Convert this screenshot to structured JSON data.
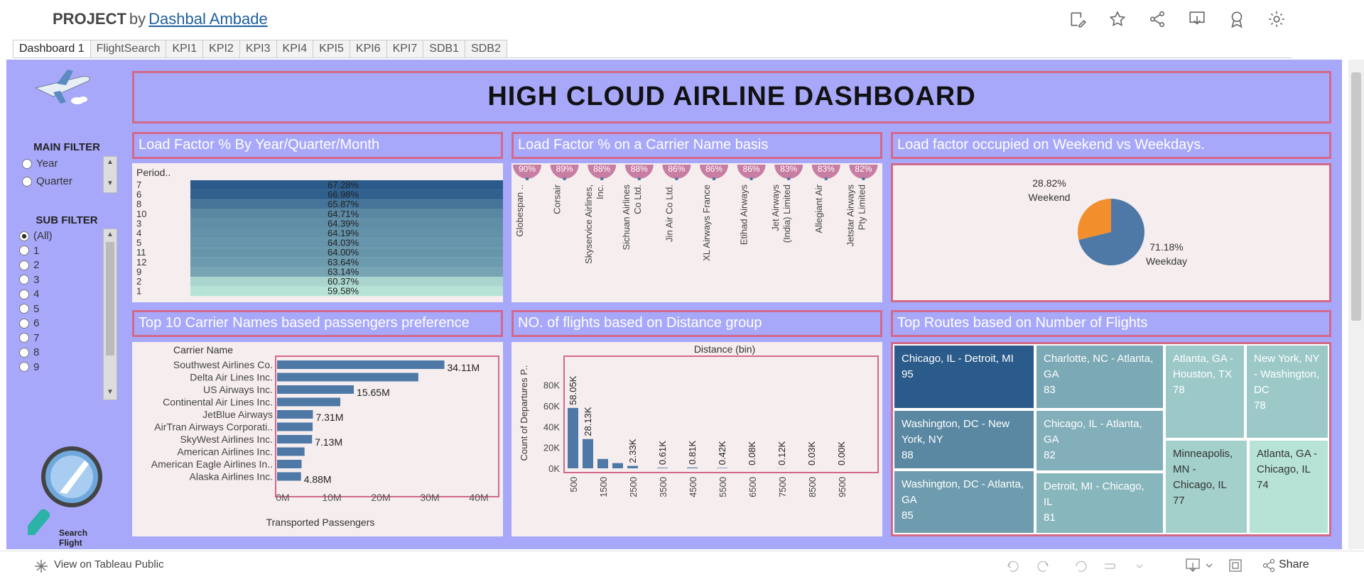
{
  "header": {
    "title": "PROJECT",
    "by": "by",
    "author": "Dashbal Ambade"
  },
  "tabs": [
    "Dashboard 1",
    "FlightSearch",
    "KPI1",
    "KPI2",
    "KPI3",
    "KPI4",
    "KPI5",
    "KPI6",
    "KPI7",
    "SDB1",
    "SDB2"
  ],
  "banner": "HIGH CLOUD AIRLINE DASHBOARD",
  "sidebar": {
    "main_filter": {
      "title": "MAIN FILTER",
      "options": [
        "Year",
        "Quarter"
      ]
    },
    "sub_filter": {
      "title": "SUB FILTER",
      "options": [
        "(All)",
        "1",
        "2",
        "3",
        "4",
        "5",
        "6",
        "7",
        "8",
        "9"
      ],
      "selected": "(All)"
    },
    "search_label": "Search Flight"
  },
  "panels": {
    "p1": "Load Factor % By Year/Quarter/Month",
    "p2": "Load Factor % on a Carrier Name basis",
    "p3": "Load factor occupied on Weekend vs Weekdays.",
    "p4": "Top 10 Carrier Names based passengers preference",
    "p5": "NO. of flights based on Distance group",
    "p6": "Top Routes based on Number of Flights"
  },
  "chart_data": [
    {
      "type": "bar",
      "header": "Period..",
      "categories": [
        "7",
        "6",
        "8",
        "10",
        "3",
        "4",
        "5",
        "11",
        "12",
        "9",
        "2",
        "1"
      ],
      "values": [
        67.28,
        66.98,
        65.87,
        64.71,
        64.39,
        64.19,
        64.03,
        64.0,
        63.64,
        63.14,
        60.37,
        59.58
      ],
      "labels": [
        "67.28%",
        "66.98%",
        "65.87%",
        "64.71%",
        "64.39%",
        "64.19%",
        "64.03%",
        "64.00%",
        "63.64%",
        "63.14%",
        "60.37%",
        "59.58%"
      ],
      "colors": {
        "high": "#2b5b8a",
        "low": "#b7e3d6"
      }
    },
    {
      "type": "bar",
      "categories": [
        "Globespan ..",
        "Corsair",
        "Skyservice Airlines, Inc.",
        "Sichuan Airlines Co Ltd.",
        "Jin Air Co Ltd.",
        "XL Airways France",
        "Etihad Airways",
        "Jet Airways (India) Limited",
        "Allegiant Air",
        "Jetstar Airways Pty Limited"
      ],
      "labels": [
        "90%",
        "89%",
        "88%",
        "88%",
        "86%",
        "86%",
        "86%",
        "83%",
        "83%",
        "82%"
      ],
      "values": [
        90,
        89,
        88,
        88,
        86,
        86,
        86,
        83,
        83,
        82
      ],
      "color": "#c87ea3"
    },
    {
      "type": "pie",
      "categories": [
        "Weekend",
        "Weekday"
      ],
      "values": [
        28.82,
        71.18
      ],
      "labels": [
        "28.82%",
        "71.18%"
      ],
      "colors": [
        "#f28e2b",
        "#4e79a7"
      ]
    },
    {
      "type": "bar",
      "header": "Carrier Name",
      "categories": [
        "Southwest Airlines Co.",
        "Delta Air Lines Inc.",
        "US Airways Inc.",
        "Continental Air Lines Inc.",
        "JetBlue Airways",
        "AirTran Airways Corporati..",
        "SkyWest Airlines Inc.",
        "American Airlines Inc.",
        "American Eagle Airlines In..",
        "Alaska Airlines Inc."
      ],
      "values": [
        34.11,
        28.8,
        15.65,
        12.9,
        7.31,
        7.25,
        7.13,
        5.6,
        5.0,
        4.88
      ],
      "labels": [
        "34.11M",
        "",
        "15.65M",
        "",
        "7.31M",
        "",
        "7.13M",
        "",
        "",
        "4.88M"
      ],
      "xlabel": "Transported Passengers",
      "xticks": [
        "0M",
        "10M",
        "20M",
        "30M",
        "40M"
      ],
      "xlim": [
        0,
        42
      ],
      "color": "#4e79a7"
    },
    {
      "type": "bar",
      "title": "Distance (bin)",
      "ylabel": "Count of Departures P..",
      "x": [
        500,
        1000,
        1500,
        2000,
        2500,
        3000,
        3500,
        4000,
        4500,
        5000,
        5500,
        6000,
        6500,
        7000,
        7500,
        8000,
        8500,
        9000,
        9500
      ],
      "values": [
        58050,
        28130,
        9000,
        5000,
        2330,
        0,
        610,
        0,
        810,
        0,
        420,
        0,
        80,
        0,
        120,
        0,
        30,
        0,
        0
      ],
      "labels": [
        "58.05K",
        "28.13K",
        "",
        "",
        "2.33K",
        "",
        "0.61K",
        "",
        "0.81K",
        "",
        "0.42K",
        "",
        "0.08K",
        "",
        "0.12K",
        "",
        "0.03K",
        "",
        "0.00K"
      ],
      "xticks": [
        "500",
        "1500",
        "2500",
        "3500",
        "4500",
        "5500",
        "6500",
        "7500",
        "8500",
        "9500"
      ],
      "yticks": [
        "0K",
        "20K",
        "40K",
        "60K",
        "80K"
      ],
      "ylim": [
        0,
        90000
      ],
      "color": "#4e79a7"
    },
    {
      "type": "treemap",
      "items": [
        {
          "name": "Chicago, IL - Detroit, MI",
          "value": 95
        },
        {
          "name": "Washington, DC - New York, NY",
          "value": 88
        },
        {
          "name": "Washington, DC - Atlanta, GA",
          "value": 85
        },
        {
          "name": "Charlotte, NC - Atlanta, GA",
          "value": 83
        },
        {
          "name": "Chicago, IL - Atlanta, GA",
          "value": 82
        },
        {
          "name": "Detroit, MI - Chicago, IL",
          "value": 81
        },
        {
          "name": "Atlanta, GA - Houston, TX",
          "value": 78
        },
        {
          "name": "New York, NY - Washington, DC",
          "value": 78
        },
        {
          "name": "Minneapolis, MN - Chicago, IL",
          "value": 77
        },
        {
          "name": "Atlanta, GA - Chicago, IL",
          "value": 74
        }
      ]
    }
  ],
  "footer": {
    "view_label": "View on Tableau Public",
    "share_label": "Share"
  }
}
